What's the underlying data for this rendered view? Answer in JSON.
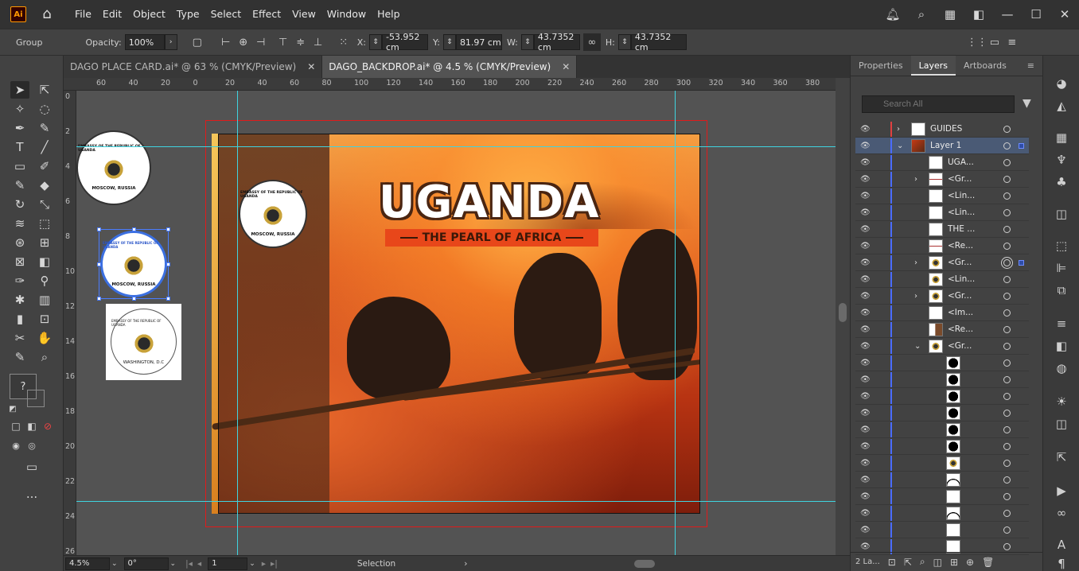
{
  "app": {
    "logo": "Ai"
  },
  "menu": [
    "File",
    "Edit",
    "Object",
    "Type",
    "Select",
    "Effect",
    "View",
    "Window",
    "Help"
  ],
  "control": {
    "selection_type": "Group",
    "opacity_label": "Opacity:",
    "opacity_value": "100%",
    "x_label": "X:",
    "x_value": "-53.952 cm",
    "y_label": "Y:",
    "y_value": "81.97 cm",
    "w_label": "W:",
    "w_value": "43.7352 cm",
    "h_label": "H:",
    "h_value": "43.7352 cm"
  },
  "tabs": [
    {
      "label": "DAGO PLACE CARD.ai* @ 63 % (CMYK/Preview)",
      "active": false
    },
    {
      "label": "DAGO_BACKDROP.ai* @ 4.5 % (CMYK/Preview)",
      "active": true
    }
  ],
  "ruler_top": [
    "60",
    "40",
    "20",
    "0",
    "20",
    "40",
    "60",
    "80",
    "100",
    "120",
    "140",
    "160",
    "180",
    "200",
    "220",
    "240",
    "260",
    "280",
    "300",
    "320",
    "340",
    "360",
    "380"
  ],
  "ruler_left": [
    "0",
    "2",
    "4",
    "6",
    "8",
    "10",
    "12",
    "14",
    "16",
    "18",
    "20",
    "22",
    "24",
    "26"
  ],
  "artwork": {
    "title": "UGANDA",
    "subtitle": "THE PEARL OF AFRICA",
    "seal_ring": "EMBASSY OF THE REPUBLIC OF UGANDA",
    "seal_city_moscow": "MOSCOW, RUSSIA",
    "seal_city_washington": "WASHINGTON, D.C"
  },
  "tools_extra": {
    "question": "?",
    "more": "..."
  },
  "panel": {
    "tabs": [
      "Properties",
      "Layers",
      "Artboards"
    ],
    "active_tab": "Layers",
    "search_placeholder": "Search All",
    "footer_count": "2 La..."
  },
  "layers": [
    {
      "name": "GUIDES",
      "level": 0,
      "expander": "›",
      "thumb": "white",
      "color": "#e04040"
    },
    {
      "name": "Layer 1",
      "level": 0,
      "expander": "⌄",
      "thumb": "image",
      "color": "#4a6cff",
      "selected": true
    },
    {
      "name": "UGA...",
      "level": 1,
      "expander": "",
      "thumb": "white"
    },
    {
      "name": "<Gr...",
      "level": 1,
      "expander": "›",
      "thumb": "line"
    },
    {
      "name": "<Lin...",
      "level": 1,
      "expander": "",
      "thumb": "white"
    },
    {
      "name": "<Lin...",
      "level": 1,
      "expander": "",
      "thumb": "white"
    },
    {
      "name": "THE ...",
      "level": 1,
      "expander": "",
      "thumb": "white"
    },
    {
      "name": "<Re...",
      "level": 1,
      "expander": "",
      "thumb": "line"
    },
    {
      "name": "<Gr...",
      "level": 1,
      "expander": "›",
      "thumb": "seal",
      "targeted": true
    },
    {
      "name": "<Lin...",
      "level": 1,
      "expander": "",
      "thumb": "seal"
    },
    {
      "name": "<Gr...",
      "level": 1,
      "expander": "›",
      "thumb": "seal"
    },
    {
      "name": "<Im...",
      "level": 1,
      "expander": "",
      "thumb": "white"
    },
    {
      "name": "<Re...",
      "level": 1,
      "expander": "",
      "thumb": "brown"
    },
    {
      "name": "<Gr...",
      "level": 1,
      "expander": "⌄",
      "thumb": "seal"
    },
    {
      "name": "",
      "level": 2,
      "expander": "",
      "thumb": "black"
    },
    {
      "name": "",
      "level": 2,
      "expander": "",
      "thumb": "black"
    },
    {
      "name": "",
      "level": 2,
      "expander": "",
      "thumb": "black"
    },
    {
      "name": "",
      "level": 2,
      "expander": "",
      "thumb": "black"
    },
    {
      "name": "",
      "level": 2,
      "expander": "",
      "thumb": "black"
    },
    {
      "name": "",
      "level": 2,
      "expander": "",
      "thumb": "black"
    },
    {
      "name": "",
      "level": 2,
      "expander": "",
      "thumb": "seal"
    },
    {
      "name": "",
      "level": 2,
      "expander": "",
      "thumb": "arc"
    },
    {
      "name": "",
      "level": 2,
      "expander": "",
      "thumb": "white"
    },
    {
      "name": "",
      "level": 2,
      "expander": "",
      "thumb": "arc"
    },
    {
      "name": "",
      "level": 2,
      "expander": "",
      "thumb": "white"
    },
    {
      "name": "",
      "level": 2,
      "expander": "",
      "thumb": "white"
    }
  ],
  "status": {
    "zoom": "4.5%",
    "rotation": "0°",
    "artboard_num": "1",
    "tool": "Selection"
  },
  "colors": {
    "accent": "#4a7cff",
    "guide": "#3fd4e0",
    "bleed": "#e01b1b"
  }
}
